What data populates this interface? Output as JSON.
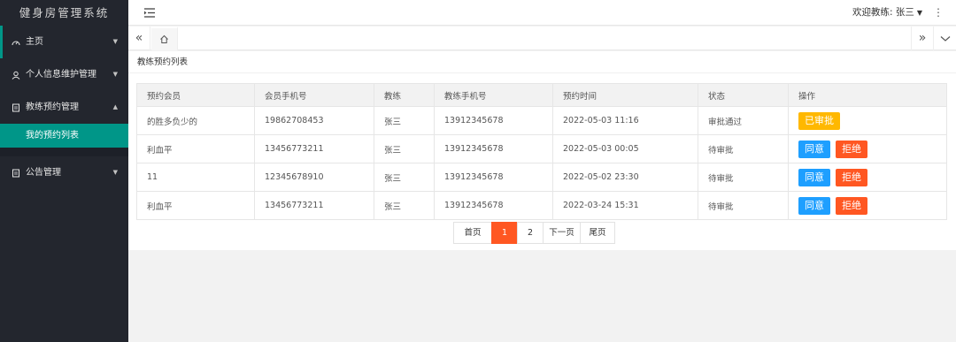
{
  "app": {
    "title": "健身房管理系统"
  },
  "sidebar": {
    "items": [
      {
        "label": "主页",
        "icon": "dashboard-icon",
        "arrow": "▼"
      },
      {
        "label": "个人信息维护管理",
        "icon": "user-icon",
        "arrow": "▼"
      },
      {
        "label": "教练预约管理",
        "icon": "document-icon",
        "arrow": "▲"
      },
      {
        "label": "公告管理",
        "icon": "document-icon",
        "arrow": "▼"
      }
    ],
    "sub_items": [
      {
        "label": "我的预约列表"
      }
    ]
  },
  "header": {
    "user_label": "欢迎教练: 张三",
    "caret": "▼",
    "more": "⋮"
  },
  "tabs": {
    "left_arrow": "«",
    "right_arrow": "»"
  },
  "panel": {
    "title": "教练预约列表"
  },
  "table": {
    "headers": [
      "预约会员",
      "会员手机号",
      "教练",
      "教练手机号",
      "预约时间",
      "状态",
      "操作"
    ],
    "rows": [
      {
        "member": "的胜多负少的",
        "member_phone": "19862708453",
        "coach": "张三",
        "coach_phone": "13912345678",
        "time": "2022-05-03 11:16",
        "status": "审批通过",
        "status_type": "ok",
        "actions": [
          "已审批"
        ]
      },
      {
        "member": "利血平",
        "member_phone": "13456773211",
        "coach": "张三",
        "coach_phone": "13912345678",
        "time": "2022-05-03 00:05",
        "status": "待审批",
        "status_type": "wait",
        "actions": [
          "同意",
          "拒绝"
        ]
      },
      {
        "member": "11",
        "member_phone": "12345678910",
        "coach": "张三",
        "coach_phone": "13912345678",
        "time": "2022-05-02 23:30",
        "status": "待审批",
        "status_type": "wait",
        "actions": [
          "同意",
          "拒绝"
        ]
      },
      {
        "member": "利血平",
        "member_phone": "13456773211",
        "coach": "张三",
        "coach_phone": "13912345678",
        "time": "2022-03-24 15:31",
        "status": "待审批",
        "status_type": "wait",
        "actions": [
          "同意",
          "拒绝"
        ]
      }
    ]
  },
  "pagination": {
    "first": "首页",
    "pages": [
      "1",
      "2"
    ],
    "current": "1",
    "next": "下一页",
    "last": "尾页"
  },
  "colors": {
    "sidebar_bg": "#23262e",
    "accent": "#009688",
    "approved": "#ffb800",
    "agree": "#1e9fff",
    "reject": "#ff5722",
    "status_ok": "#19a05a",
    "status_wait": "#2a2aee"
  }
}
